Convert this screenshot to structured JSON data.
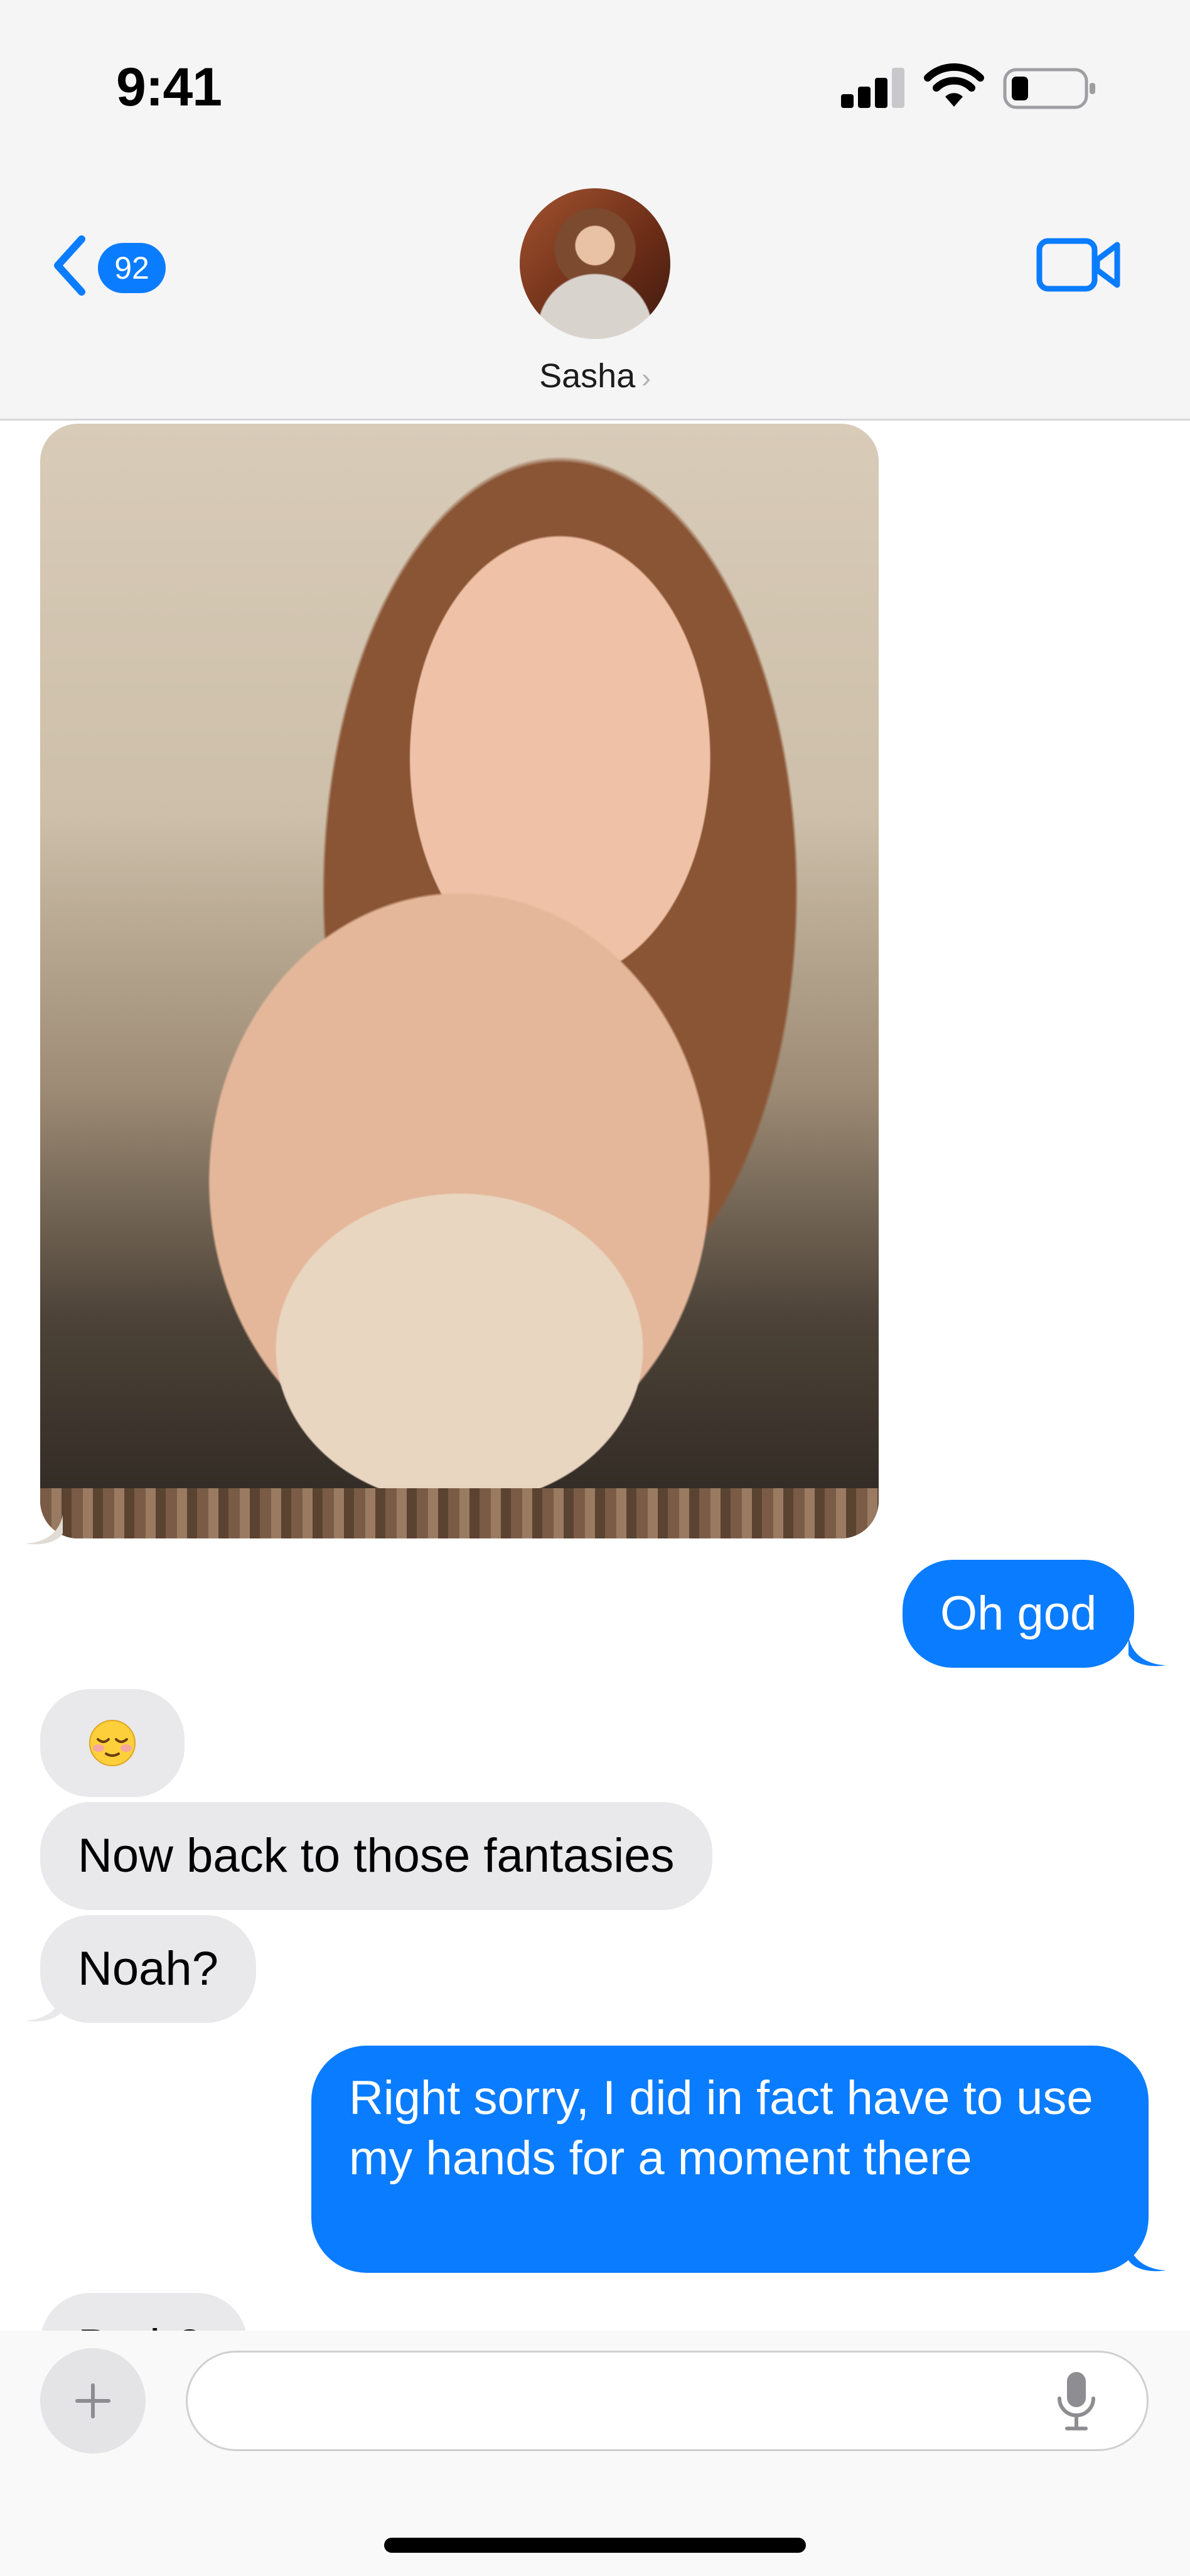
{
  "status_bar": {
    "time": "9:41"
  },
  "header": {
    "back_badge": "92",
    "contact_name": "Sasha",
    "icons": {
      "back": "chevron-left-icon",
      "video": "video-camera-icon",
      "contact_chevron": "chevron-right-icon"
    }
  },
  "messages": [
    {
      "side": "incoming",
      "kind": "photo"
    },
    {
      "side": "outgoing",
      "text": "Oh god"
    },
    {
      "side": "incoming",
      "text": "😌"
    },
    {
      "side": "incoming",
      "text": "Now back to those fantasies"
    },
    {
      "side": "incoming",
      "text": "Noah?"
    },
    {
      "side": "outgoing",
      "text": "Right sorry, I did in fact have to use my hands for a moment there"
    },
    {
      "side": "incoming",
      "text": "Both?"
    }
  ],
  "composer": {
    "placeholder": ""
  },
  "colors": {
    "accent": "#0a7cff",
    "incoming_bubble": "#e9e9eb",
    "header_bg": "#f5f5f5"
  }
}
